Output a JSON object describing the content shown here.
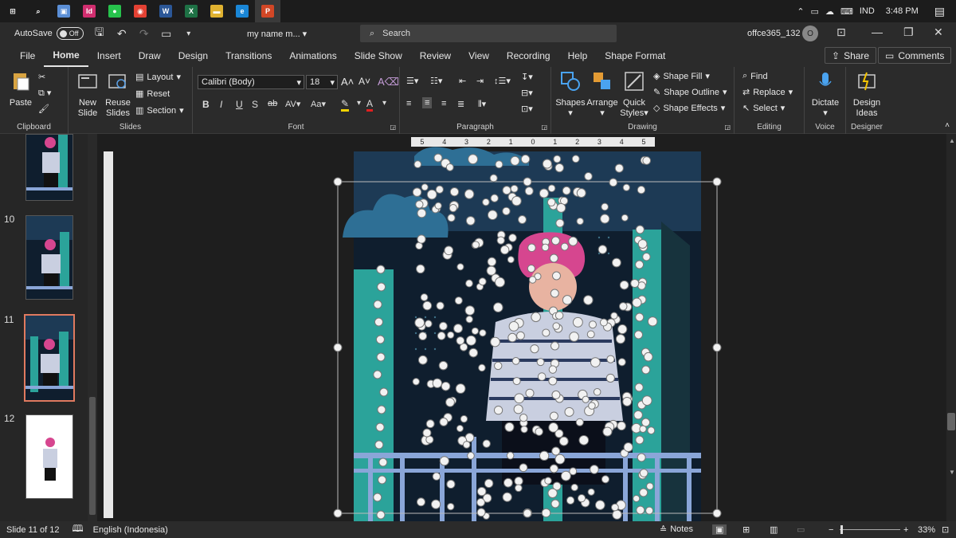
{
  "taskbar": {
    "apps": [
      {
        "name": "windows-start-icon",
        "glyph": "⊞",
        "color": "#1c1c1c"
      },
      {
        "name": "search-icon",
        "glyph": "⌕",
        "color": "#1c1c1c"
      },
      {
        "name": "photos-app-icon",
        "glyph": "▣",
        "color": "#5b8fd6"
      },
      {
        "name": "indesign-app-icon",
        "glyph": "Id",
        "color": "#d12e6f"
      },
      {
        "name": "line-app-icon",
        "glyph": "●",
        "color": "#27c24c"
      },
      {
        "name": "chrome-app-icon",
        "glyph": "◉",
        "color": "#e34133"
      },
      {
        "name": "word-app-icon",
        "glyph": "W",
        "color": "#2b5797"
      },
      {
        "name": "excel-app-icon",
        "glyph": "X",
        "color": "#1e7145"
      },
      {
        "name": "file-explorer-icon",
        "glyph": "▬",
        "color": "#e0b230"
      },
      {
        "name": "edge-app-icon",
        "glyph": "e",
        "color": "#1a86d6"
      },
      {
        "name": "powerpoint-app-icon",
        "glyph": "P",
        "color": "#d24726"
      }
    ],
    "language": "IND",
    "time": "3:48 PM"
  },
  "titlebar": {
    "autosave_label": "AutoSave",
    "autosave_state": "Off",
    "doc_title": "my name m...",
    "search_placeholder": "Search",
    "account": "offce365_132",
    "avatar_initial": "O"
  },
  "tabs": [
    "File",
    "Home",
    "Insert",
    "Draw",
    "Design",
    "Transitions",
    "Animations",
    "Slide Show",
    "Review",
    "View",
    "Recording",
    "Help",
    "Shape Format"
  ],
  "actions": {
    "share": "Share",
    "comments": "Comments"
  },
  "ribbon": {
    "clipboard": {
      "label": "Clipboard",
      "paste": "Paste"
    },
    "slides": {
      "label": "Slides",
      "new_slide": "New Slide",
      "reuse": "Reuse Slides",
      "layout": "Layout",
      "reset": "Reset",
      "section": "Section"
    },
    "font": {
      "label": "Font",
      "font_name": "Calibri (Body)",
      "font_size": "18",
      "bold": "B",
      "italic": "I",
      "underline": "U",
      "shadow": "S",
      "strike": "ab",
      "spacing": "AV",
      "case": "Aa"
    },
    "paragraph": {
      "label": "Paragraph"
    },
    "drawing": {
      "label": "Drawing",
      "shapes": "Shapes",
      "arrange": "Arrange",
      "quick_styles": "Quick Styles",
      "shape_fill": "Shape Fill",
      "shape_outline": "Shape Outline",
      "shape_effects": "Shape Effects"
    },
    "editing": {
      "label": "Editing",
      "find": "Find",
      "replace": "Replace",
      "select": "Select"
    },
    "voice": {
      "label": "Voice",
      "dictate": "Dictate"
    },
    "designer": {
      "label": "Designer",
      "design_ideas": "Design Ideas"
    }
  },
  "slides": [
    {
      "num": "10",
      "selected": false
    },
    {
      "num": "11",
      "selected": true
    },
    {
      "num": "12",
      "selected": false
    }
  ],
  "ruler": {
    "h_ticks": [
      "5",
      "4",
      "3",
      "2",
      "1",
      "0",
      "1",
      "2",
      "3",
      "4",
      "5"
    ]
  },
  "status": {
    "slide_info": "Slide 11 of 12",
    "language": "English (Indonesia)",
    "notes": "Notes",
    "zoom": "33%"
  },
  "colors": {
    "accent": "#e07a5f",
    "teal": "#2ba39a",
    "night": "#0f1e2e",
    "sky": "#1d3a55",
    "hair": "#d6468f",
    "rail": "#8aa6d8"
  }
}
